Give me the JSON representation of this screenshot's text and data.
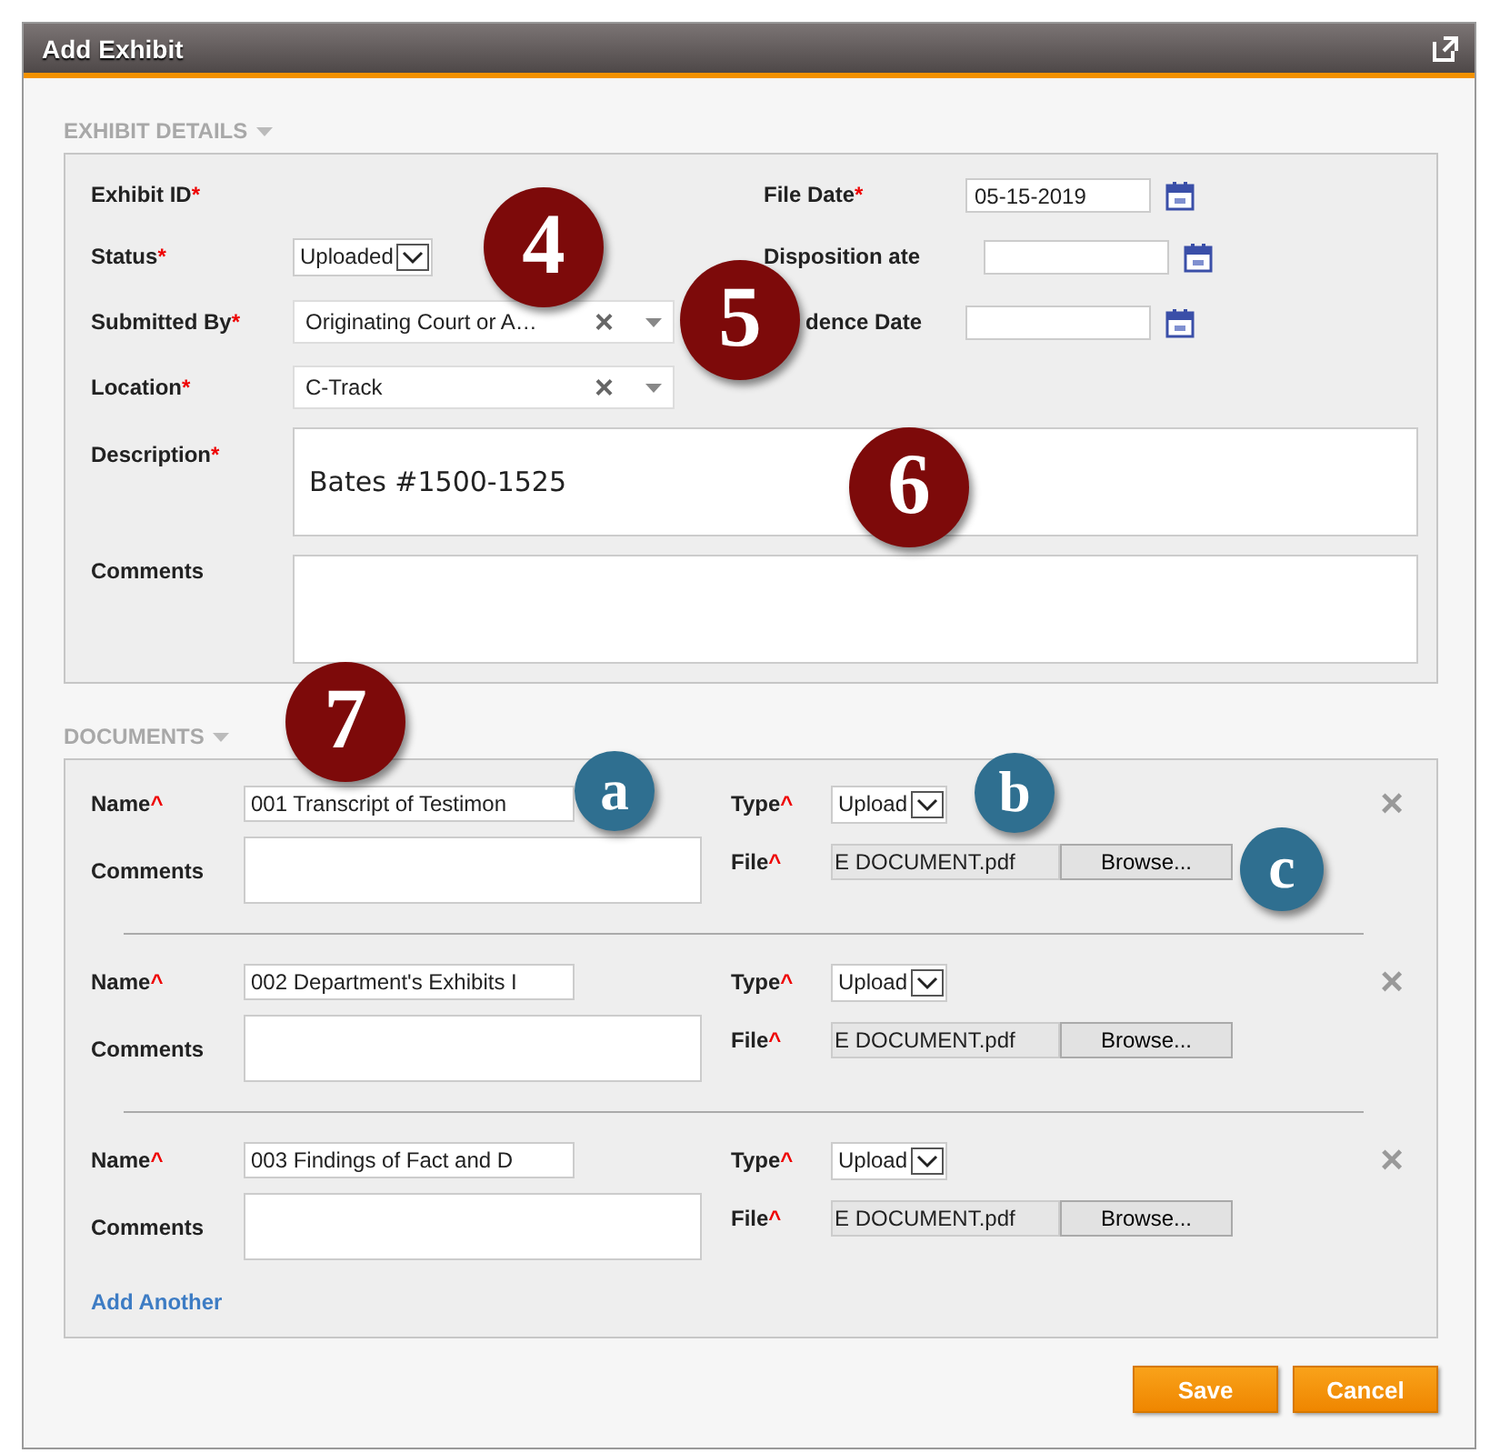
{
  "window": {
    "title": "Add Exhibit"
  },
  "exhibit_details": {
    "heading": "EXHIBIT DETAILS",
    "exhibit_id": {
      "label": "Exhibit ID",
      "mark": "*"
    },
    "status": {
      "label": "Status",
      "mark": "*",
      "value": "Uploaded"
    },
    "submitted_by": {
      "label": "Submitted By",
      "mark": "*",
      "value": "Originating Court or A…",
      "clear": "×"
    },
    "location": {
      "label": "Location",
      "mark": "*",
      "value": "C-Track",
      "clear": "×"
    },
    "file_date": {
      "label": "File Date",
      "mark": "*",
      "value": "05-15-2019"
    },
    "disposition_date": {
      "label": "Disposition ate"
    },
    "evidence_date": {
      "label": "dence Date"
    },
    "description": {
      "label": "Description",
      "mark": "*",
      "value": "Bates #1500-1525"
    },
    "comments": {
      "label": "Comments"
    }
  },
  "documents": {
    "heading": "DOCUMENTS",
    "items": [
      {
        "name_label": "Name",
        "name_mark": "^",
        "name": "001 Transcript of Testimon",
        "comments_label": "Comments",
        "type_label": "Type",
        "type_mark": "^",
        "type": "Upload",
        "file_label": "File",
        "file_mark": "^",
        "file": "E DOCUMENT.pdf",
        "browse": "Browse...",
        "remove": "×"
      },
      {
        "name_label": "Name",
        "name_mark": "^",
        "name": "002 Department's Exhibits I",
        "comments_label": "Comments",
        "type_label": "Type",
        "type_mark": "^",
        "type": "Upload",
        "file_label": "File",
        "file_mark": "^",
        "file": "E DOCUMENT.pdf",
        "browse": "Browse...",
        "remove": "×"
      },
      {
        "name_label": "Name",
        "name_mark": "^",
        "name": "003 Findings of Fact and D",
        "comments_label": "Comments",
        "type_label": "Type",
        "type_mark": "^",
        "type": "Upload",
        "file_label": "File",
        "file_mark": "^",
        "file": "E DOCUMENT.pdf",
        "browse": "Browse...",
        "remove": "×"
      }
    ],
    "add_another": "Add Another"
  },
  "buttons": [
    "Save",
    "Cancel"
  ],
  "callouts": [
    {
      "label": "4",
      "color": "#7d0a0a"
    },
    {
      "label": "5",
      "color": "#7d0a0a"
    },
    {
      "label": "6",
      "color": "#7d0a0a"
    },
    {
      "label": "7",
      "color": "#7d0a0a"
    },
    {
      "label": "a",
      "color": "#2f6f90"
    },
    {
      "label": "b",
      "color": "#2f6f90"
    },
    {
      "label": "c",
      "color": "#2f6f90"
    }
  ]
}
